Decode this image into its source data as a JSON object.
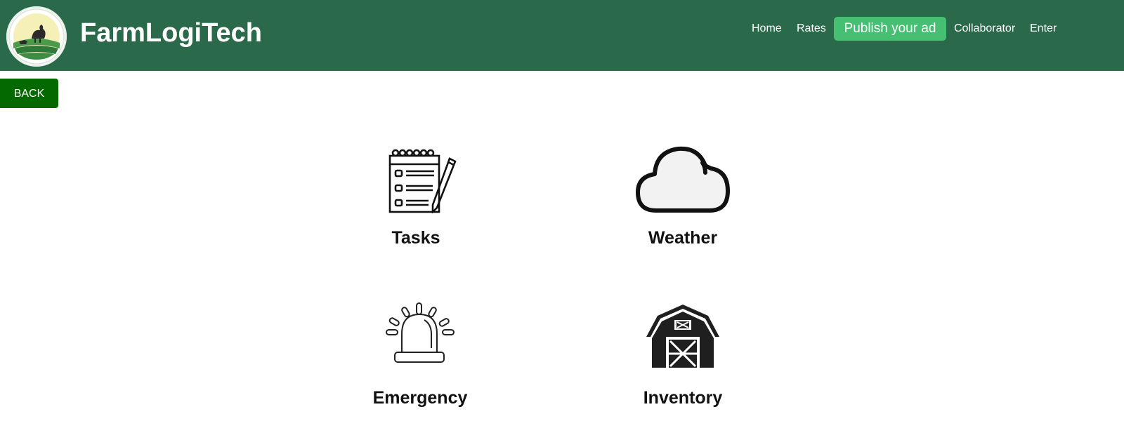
{
  "header": {
    "brand": "FarmLogiTech",
    "logo_icon": "farm-chicken-logo",
    "background_color": "#2a6a4b",
    "nav": {
      "home": "Home",
      "rates": "Rates",
      "publish": "Publish your ad",
      "collaborator": "Collaborator",
      "enter": "Enter"
    },
    "publish_color": "#46bf72"
  },
  "back_button": {
    "label": "BACK",
    "color": "#046a00"
  },
  "tiles": [
    {
      "label": "Tasks",
      "icon": "checklist-icon"
    },
    {
      "label": "Weather",
      "icon": "cloud-icon"
    },
    {
      "label": "Emergency",
      "icon": "siren-icon"
    },
    {
      "label": "Inventory",
      "icon": "barn-icon"
    }
  ]
}
